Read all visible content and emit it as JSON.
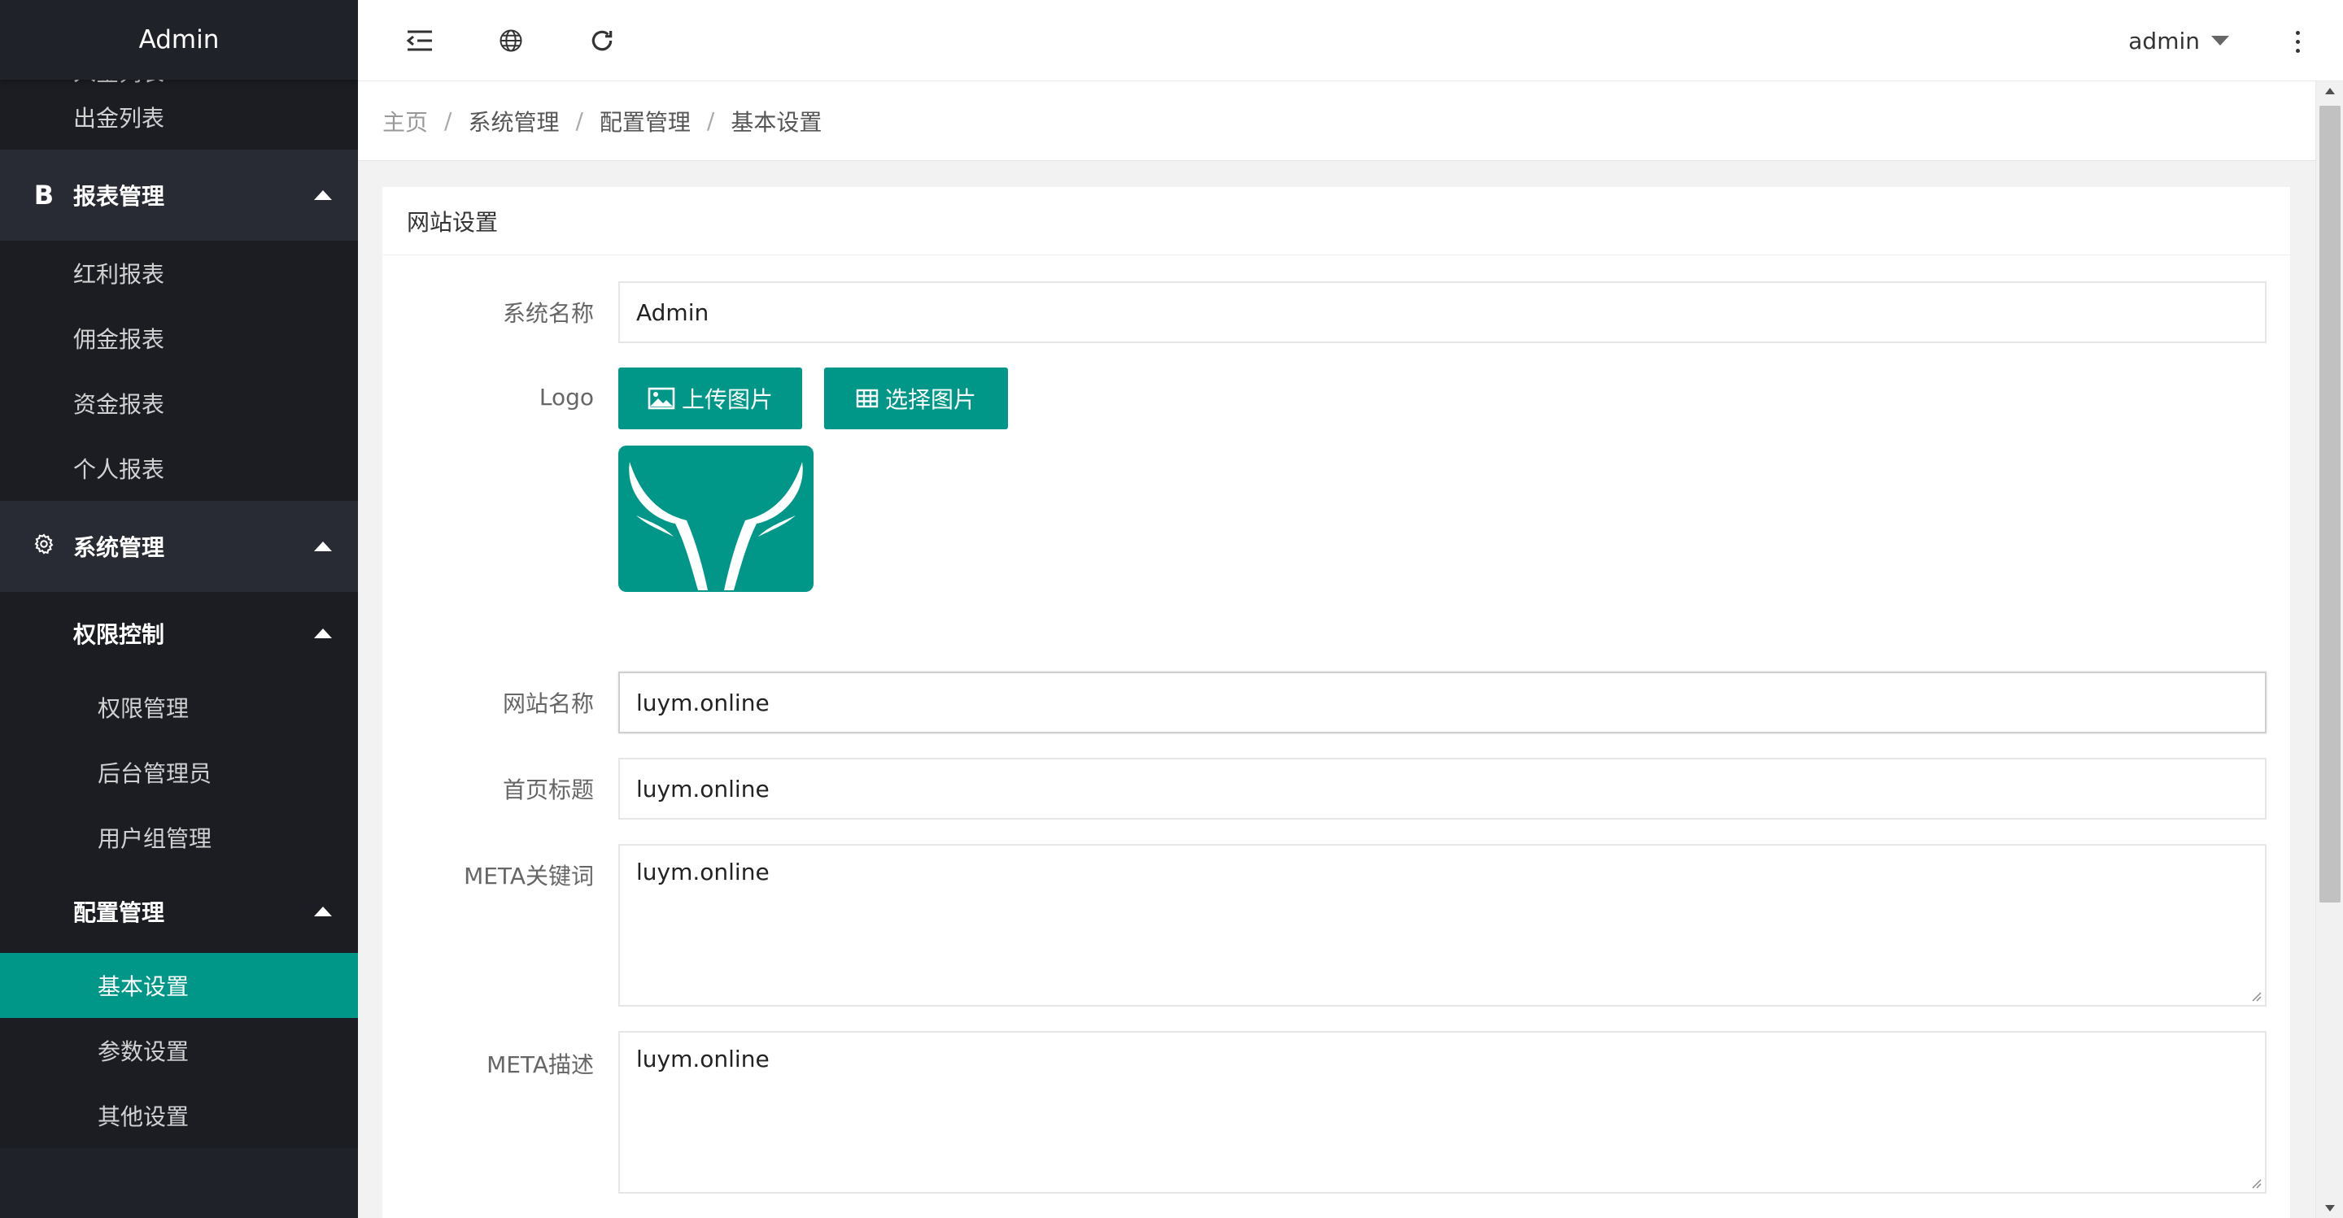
{
  "app_title": "Admin",
  "sidebar": {
    "items": [
      {
        "label": "入金列表"
      },
      {
        "label": "出金列表"
      },
      {
        "label": "报表管理",
        "icon": "B"
      },
      {
        "label": "红利报表"
      },
      {
        "label": "佣金报表"
      },
      {
        "label": "资金报表"
      },
      {
        "label": "个人报表"
      },
      {
        "label": "系统管理",
        "icon": "gear-icon"
      },
      {
        "label": "权限控制"
      },
      {
        "label": "权限管理"
      },
      {
        "label": "后台管理员"
      },
      {
        "label": "用户组管理"
      },
      {
        "label": "配置管理"
      },
      {
        "label": "基本设置",
        "active": true
      },
      {
        "label": "参数设置"
      },
      {
        "label": "其他设置"
      }
    ]
  },
  "header": {
    "user": "admin",
    "icons": [
      "menu-fold-icon",
      "globe-icon",
      "refresh-icon",
      "more-vertical-icon"
    ]
  },
  "breadcrumb": [
    "主页",
    "系统管理",
    "配置管理",
    "基本设置"
  ],
  "breadcrumb_separator": "/",
  "card": {
    "title": "网站设置",
    "fields": {
      "system_name": {
        "label": "系统名称",
        "value": "Admin"
      },
      "logo": {
        "label": "Logo",
        "upload_button": "上传图片",
        "select_button": "选择图片"
      },
      "site_name": {
        "label": "网站名称",
        "value": "luym.online"
      },
      "home_title": {
        "label": "首页标题",
        "value": "luym.online"
      },
      "meta_keywords": {
        "label": "META关键词",
        "value": "luym.online"
      },
      "meta_description": {
        "label": "META描述",
        "value": "luym.online"
      }
    }
  },
  "colors": {
    "accent": "#009688",
    "sidebar_bg": "#20222a",
    "sidebar_group_bg": "#282b33",
    "sidebar_sub_bg": "#1b1d23"
  }
}
